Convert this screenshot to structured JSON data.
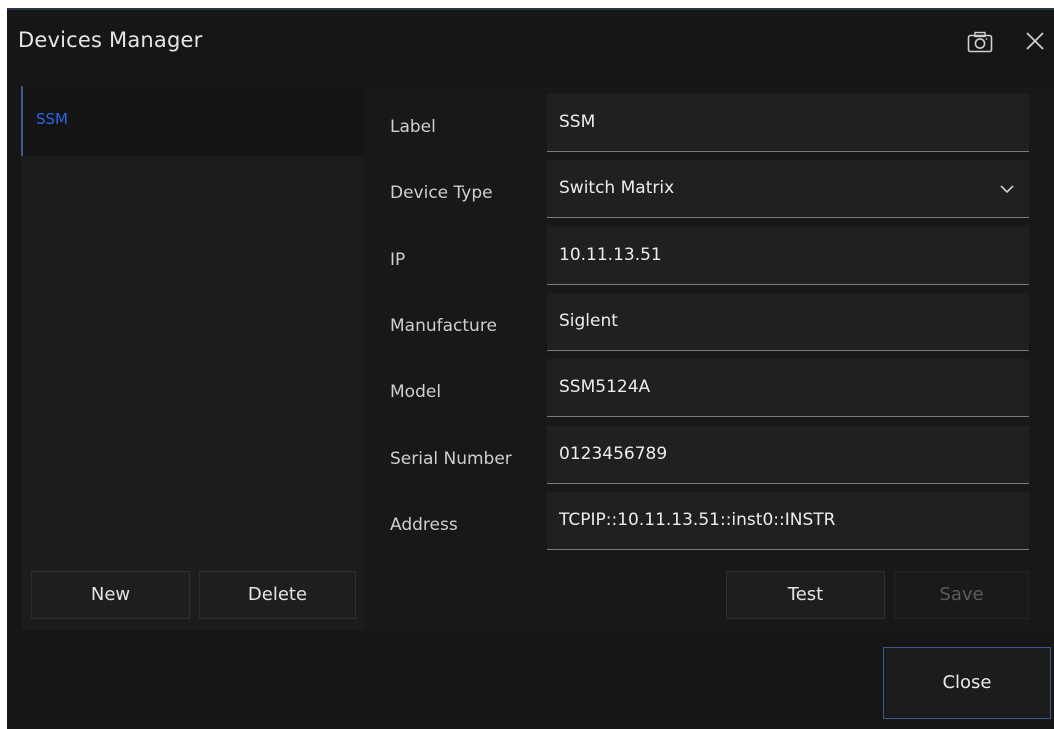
{
  "window": {
    "title": "Devices Manager",
    "icons": {
      "screenshot": "camera-icon",
      "close": "close-icon"
    }
  },
  "device_list": {
    "items": [
      {
        "label": "SSM",
        "selected": true
      }
    ],
    "new_label": "New",
    "delete_label": "Delete"
  },
  "form": {
    "fields": [
      {
        "label": "Label",
        "value": "SSM"
      },
      {
        "label": "Device Type",
        "value": "Switch Matrix"
      },
      {
        "label": "IP",
        "value": "10.11.13.51"
      },
      {
        "label": "Manufacture",
        "value": "Siglent"
      },
      {
        "label": "Model",
        "value": "SSM5124A"
      },
      {
        "label": "Serial Number",
        "value": "0123456789"
      },
      {
        "label": "Address",
        "value": "TCPIP::10.11.13.51::inst0::INSTR"
      }
    ],
    "test_label": "Test",
    "save_label": "Save"
  },
  "footer": {
    "close_label": "Close"
  },
  "colors": {
    "background": "#161616",
    "selected_text": "#2c66e8",
    "accent_border": "#3a5a8e"
  }
}
